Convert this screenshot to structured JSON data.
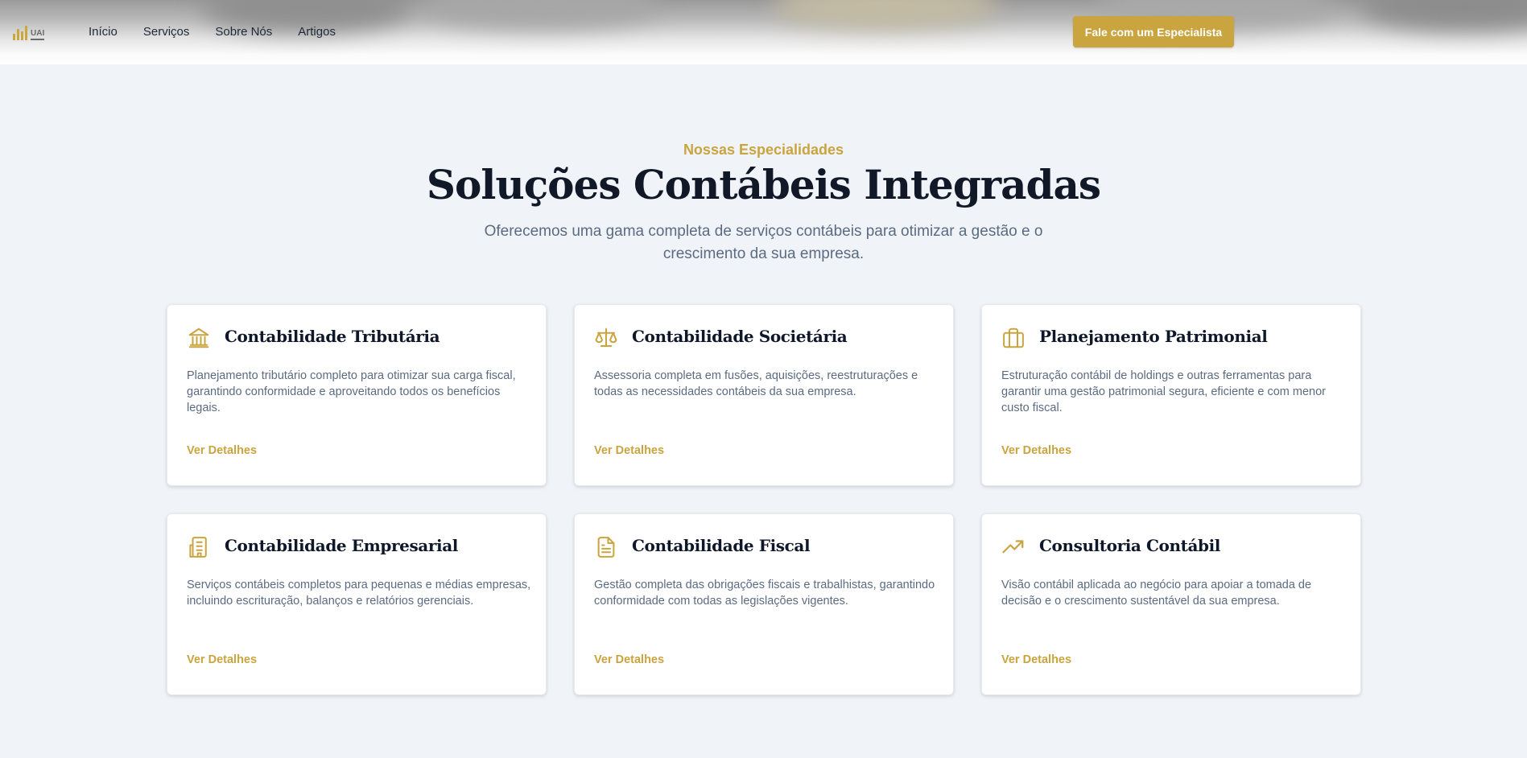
{
  "header": {
    "logo_text": "UAI",
    "nav": [
      "Início",
      "Serviços",
      "Sobre Nós",
      "Artigos"
    ],
    "cta_label": "Fale com um Especialista"
  },
  "section": {
    "eyebrow": "Nossas Especialidades",
    "title": "Soluções Contábeis Integradas",
    "subtitle": "Oferecemos uma gama completa de serviços contábeis para otimizar a gestão e o crescimento da sua empresa."
  },
  "cards": [
    {
      "icon": "bank-icon",
      "title": "Contabilidade Tributária",
      "description": "Planejamento tributário completo para otimizar sua carga fiscal, garantindo conformidade e aproveitando todos os benefícios legais.",
      "link": "Ver Detalhes"
    },
    {
      "icon": "scale-icon",
      "title": "Contabilidade Societária",
      "description": "Assessoria completa em fusões, aquisições, reestruturações e todas as necessidades contábeis da sua empresa.",
      "link": "Ver Detalhes"
    },
    {
      "icon": "briefcase-icon",
      "title": "Planejamento Patrimonial",
      "description": "Estruturação contábil de holdings e outras ferramentas para garantir uma gestão patrimonial segura, eficiente e com menor custo fiscal.",
      "link": "Ver Detalhes"
    },
    {
      "icon": "building-icon",
      "title": "Contabilidade Empresarial",
      "description": "Serviços contábeis completos para pequenas e médias empresas, incluindo escrituração, balanços e relatórios gerenciais.",
      "link": "Ver Detalhes"
    },
    {
      "icon": "document-icon",
      "title": "Contabilidade Fiscal",
      "description": "Gestão completa das obrigações fiscais e trabalhistas, garantindo conformidade com todas as legislações vigentes.",
      "link": "Ver Detalhes"
    },
    {
      "icon": "trending-up-icon",
      "title": "Consultoria Contábil",
      "description": "Visão contábil aplicada ao negócio para apoiar a tomada de decisão e o crescimento sustentável da sua empresa.",
      "link": "Ver Detalhes"
    }
  ],
  "colors": {
    "accent": "#c9a43f",
    "background": "#f0f3f7",
    "heading": "#111827",
    "body_text": "#5b6b82"
  }
}
